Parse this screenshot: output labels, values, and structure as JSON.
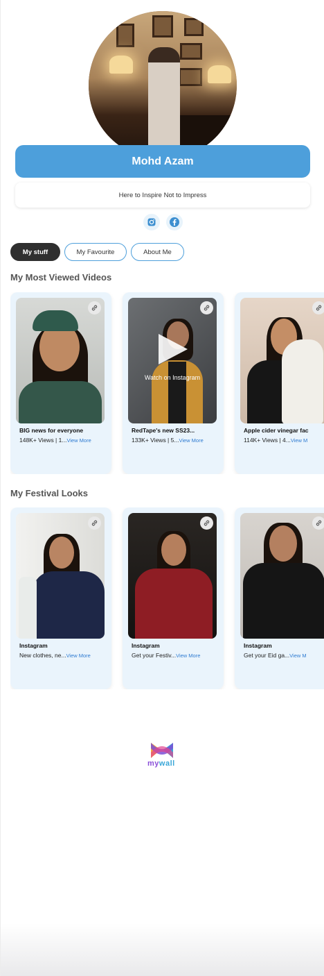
{
  "profile": {
    "name": "Mohd Azam",
    "tagline": "Here to Inspire Not to Impress",
    "social": [
      "instagram-icon",
      "facebook-icon"
    ]
  },
  "tabs": [
    {
      "label": "My stuff",
      "active": true
    },
    {
      "label": "My Favourite",
      "active": false
    },
    {
      "label": "About Me",
      "active": false
    }
  ],
  "sections": [
    {
      "title": "My Most Viewed Videos",
      "cards": [
        {
          "title": "BIG news for everyone",
          "sub": "148K+ Views | 1...",
          "more": "View More"
        },
        {
          "title": "RedTape's new SS23...",
          "sub": "133K+ Views | 5...",
          "more": "View More",
          "overlay": "Watch on Instagram"
        },
        {
          "title": "Apple cider vinegar fac",
          "sub": "114K+ Views | 4...",
          "more": "View M"
        }
      ]
    },
    {
      "title": "My Festival Looks",
      "cards": [
        {
          "title": "Instagram",
          "sub": "New clothes, ne...",
          "more": "View More"
        },
        {
          "title": "Instagram",
          "sub": "Get your Festiv...",
          "more": "View More"
        },
        {
          "title": "Instagram",
          "sub": "Get your Eid ga...",
          "more": "View M"
        }
      ]
    }
  ],
  "footer": {
    "logo_a": "my",
    "logo_b": "wall"
  },
  "colors": {
    "accent": "#4d9fdb",
    "card_bg": "#eaf4fc",
    "link": "#2f7bd1",
    "active_tab": "#2f2f2f"
  }
}
